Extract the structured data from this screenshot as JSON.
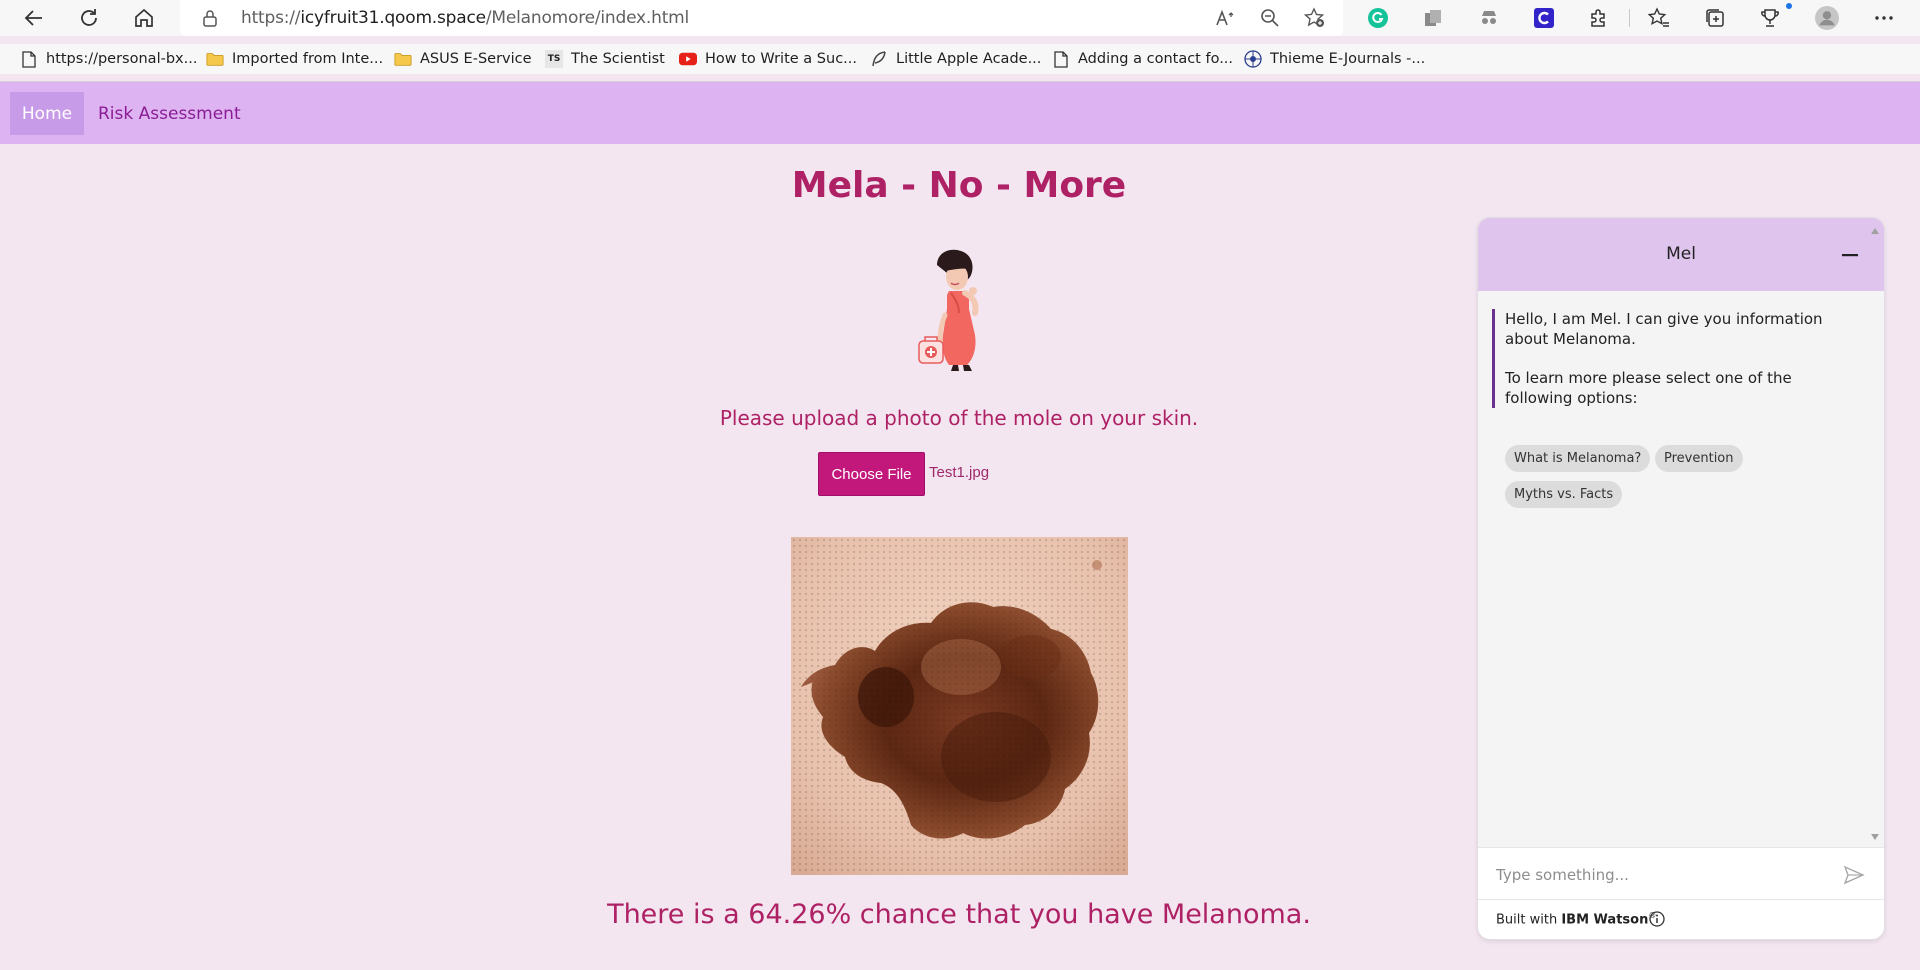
{
  "browser": {
    "url_prefix": "https://",
    "url_host": "icyfruit31.qoom.space",
    "url_path": "/Melanomore/index.html",
    "bookmarks": [
      {
        "label": "https://personal-bx...",
        "icon": "page-icon"
      },
      {
        "label": "Imported from Inte...",
        "icon": "folder-icon"
      },
      {
        "label": "ASUS E-Service",
        "icon": "folder-icon"
      },
      {
        "label": "The Scientist",
        "icon": "ts-logo-icon"
      },
      {
        "label": "How to Write a Suc...",
        "icon": "youtube-icon"
      },
      {
        "label": "Little Apple Acade...",
        "icon": "feather-icon"
      },
      {
        "label": "Adding a contact fo...",
        "icon": "page-icon"
      },
      {
        "label": "Thieme E-Journals -...",
        "icon": "thieme-logo-icon"
      }
    ],
    "ts_logo_text": "TS"
  },
  "nav": {
    "home_label": "Home",
    "risk_label": "Risk Assessment"
  },
  "main": {
    "title": "Mela - No - More",
    "prompt": "Please upload a photo of the mole on your skin.",
    "choose_file_label": "Choose File",
    "file_name": "Test1.jpg",
    "result": "There is a 64.26% chance that you have Melanoma."
  },
  "chat": {
    "bot_name": "Mel",
    "greeting": "Hello, I am Mel. I can give you information about Melanoma.",
    "instruction": "To learn more please select one of the following options:",
    "options": [
      "What is Melanoma?",
      "Prevention",
      "Myths vs. Facts"
    ],
    "input_placeholder": "Type something...",
    "footer_prefix": "Built with",
    "footer_brand": "IBM Watson",
    "footer_mark": "®"
  },
  "colors": {
    "page_bg": "#f3e6f1",
    "nav_bg": "#deb3f1",
    "nav_active_bg": "#c89be8",
    "accent_text": "#ae2265",
    "button_bg": "#c2187c",
    "chat_header_bg": "#dfc4ed"
  }
}
